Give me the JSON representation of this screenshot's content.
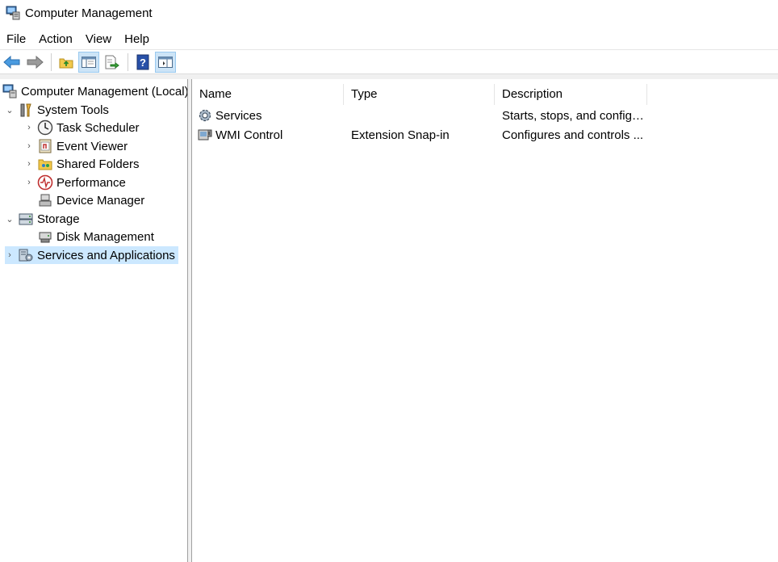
{
  "window": {
    "title": "Computer Management"
  },
  "menu": [
    "File",
    "Action",
    "View",
    "Help"
  ],
  "toolbar": {
    "buttons": [
      {
        "name": "back-arrow-icon",
        "active": false
      },
      {
        "name": "forward-arrow-icon",
        "active": false
      },
      {
        "name": "up-folder-icon",
        "active": false
      },
      {
        "name": "show-hide-console-tree-icon",
        "active": true
      },
      {
        "name": "export-list-icon",
        "active": false
      },
      {
        "name": "help-icon",
        "active": false
      },
      {
        "name": "show-hide-action-pane-icon",
        "active": true
      }
    ]
  },
  "tree": {
    "items": [
      {
        "label": "Computer Management (Local)",
        "icon": "computer-management-icon",
        "expander": ""
      },
      {
        "label": "System Tools",
        "icon": "system-tools-icon",
        "expander": "expanded"
      },
      {
        "label": "Task Scheduler",
        "icon": "clock-icon",
        "expander": "collapsed"
      },
      {
        "label": "Event Viewer",
        "icon": "event-viewer-icon",
        "expander": "collapsed"
      },
      {
        "label": "Shared Folders",
        "icon": "shared-folder-icon",
        "expander": "collapsed"
      },
      {
        "label": "Performance",
        "icon": "performance-icon",
        "expander": "collapsed"
      },
      {
        "label": "Device Manager",
        "icon": "device-manager-icon",
        "expander": ""
      },
      {
        "label": "Storage",
        "icon": "storage-icon",
        "expander": "expanded"
      },
      {
        "label": "Disk Management",
        "icon": "disk-management-icon",
        "expander": ""
      },
      {
        "label": "Services and Applications",
        "icon": "services-applications-icon",
        "expander": "collapsed",
        "selected": true
      }
    ]
  },
  "list": {
    "columns": [
      "Name",
      "Type",
      "Description"
    ],
    "rows": [
      {
        "name": "Services",
        "type": "",
        "description": "Starts, stops, and configu...",
        "icon": "services-gear-icon"
      },
      {
        "name": "WMI Control",
        "type": "Extension Snap-in",
        "description": "Configures and controls ...",
        "icon": "wmi-control-icon"
      }
    ]
  },
  "colors": {
    "selection": "#cce8ff",
    "toolbar_active": "#cce4f7",
    "splitter": "#f0f0f0"
  }
}
